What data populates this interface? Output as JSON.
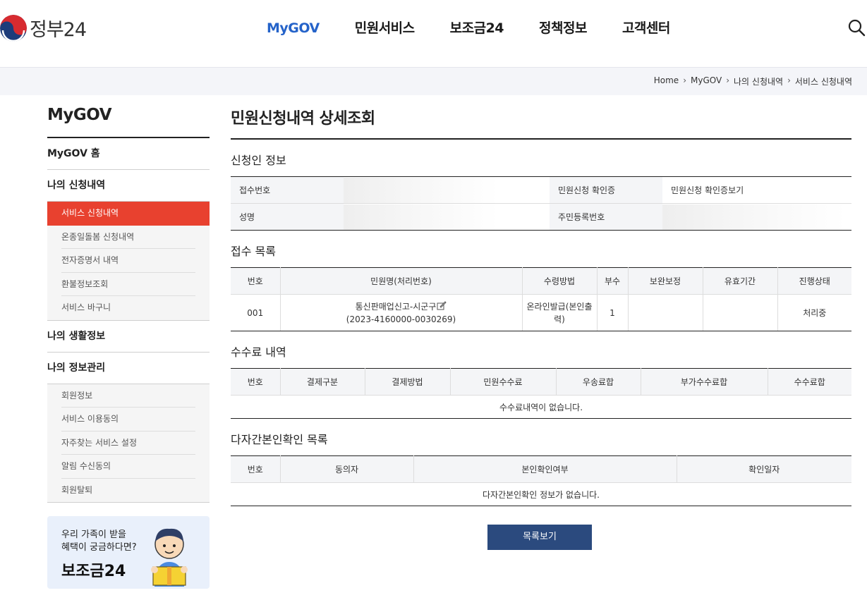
{
  "header": {
    "logo_text": "정부24",
    "nav": [
      "MyGOV",
      "민원서비스",
      "보조금24",
      "정책정보",
      "고객센터"
    ],
    "search_icon": "search-icon"
  },
  "breadcrumb": [
    "Home",
    "MyGOV",
    "나의 신청내역",
    "서비스 신청내역"
  ],
  "sidebar": {
    "title": "MyGOV",
    "home": "MyGOV 홈",
    "group1": "나의 신청내역",
    "group1_items": [
      "서비스 신청내역",
      "온종일돌봄 신청내역",
      "전자증명서 내역",
      "환불정보조회",
      "서비스 바구니"
    ],
    "group2": "나의 생활정보",
    "group3": "나의 정보관리",
    "group3_items": [
      "회원정보",
      "서비스 이용동의",
      "자주찾는 서비스 설정",
      "알림 수신동의",
      "회원탈퇴"
    ],
    "banner_line1": "우리 가족이 받을",
    "banner_line2": "혜택이 궁금하다면?",
    "banner_title": "보조금24"
  },
  "main": {
    "title": "민원신청내역 상세조회",
    "applicant": {
      "title": "신청인 정보",
      "receipt_label": "접수번호",
      "cert_label": "민원신청 확인증",
      "cert_link": "민원신청 확인증보기",
      "name_label": "성명",
      "rrn_label": "주민등록번호"
    },
    "receipt_list": {
      "title": "접수 목록",
      "headers": [
        "번호",
        "민원명(처리번호)",
        "수령방법",
        "부수",
        "보완보정",
        "유효기간",
        "진행상태"
      ],
      "row": {
        "no": "001",
        "name": "통신판매업신고-시군구",
        "proc_no": "(2023-4160000-0030269)",
        "method": "온라인발급(본인출력)",
        "copies": "1",
        "supplement": "",
        "validity": "",
        "status": "처리중"
      }
    },
    "fees": {
      "title": "수수료 내역",
      "headers": [
        "번호",
        "결제구분",
        "결제방법",
        "민원수수료",
        "우송료합",
        "부가수수료합",
        "수수료합"
      ],
      "empty": "수수료내역이 없습니다."
    },
    "multi": {
      "title": "다자간본인확인 목록",
      "headers": [
        "번호",
        "동의자",
        "본인확인여부",
        "확인일자"
      ],
      "empty": "다자간본인확인 정보가 없습니다."
    },
    "list_button": "목록보기"
  }
}
